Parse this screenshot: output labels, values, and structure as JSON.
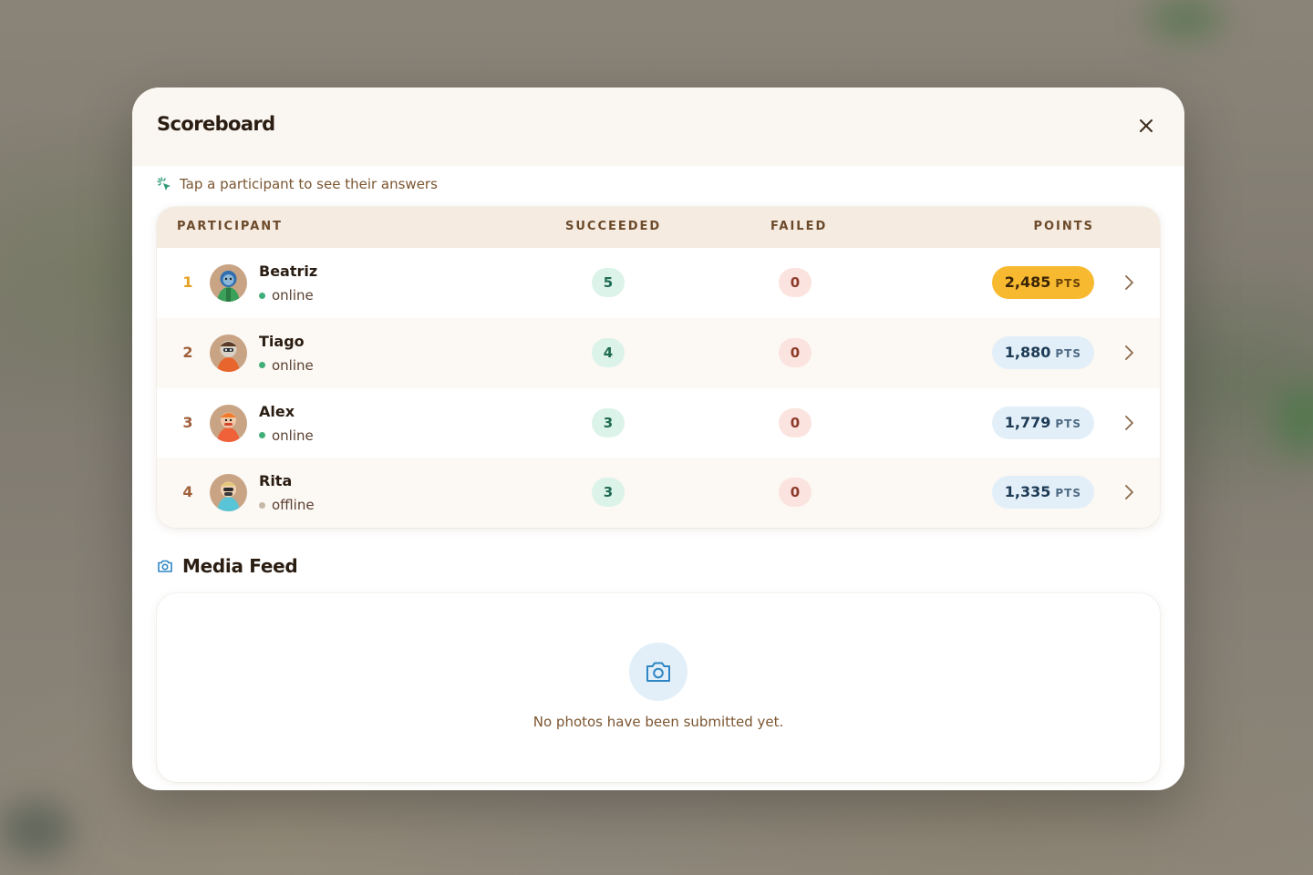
{
  "modal": {
    "title": "Scoreboard",
    "hint": "Tap a participant to see their answers"
  },
  "table": {
    "headers": {
      "participant": "PARTICIPANT",
      "succeeded": "SUCCEEDED",
      "failed": "FAILED",
      "points": "POINTS"
    },
    "rows": [
      {
        "rank": "1",
        "name": "Beatriz",
        "status": "online",
        "succeeded": "5",
        "failed": "0",
        "points": "2,485",
        "unit": "PTS"
      },
      {
        "rank": "2",
        "name": "Tiago",
        "status": "online",
        "succeeded": "4",
        "failed": "0",
        "points": "1,880",
        "unit": "PTS"
      },
      {
        "rank": "3",
        "name": "Alex",
        "status": "online",
        "succeeded": "3",
        "failed": "0",
        "points": "1,779",
        "unit": "PTS"
      },
      {
        "rank": "4",
        "name": "Rita",
        "status": "offline",
        "succeeded": "3",
        "failed": "0",
        "points": "1,335",
        "unit": "PTS"
      }
    ]
  },
  "media": {
    "title": "Media Feed",
    "empty": "No photos have been submitted yet."
  },
  "colors": {
    "gold": "#f7b930",
    "online": "#3fae78",
    "offline": "#c6b8a6",
    "succeeded_bg": "#dcf3ea",
    "failed_bg": "#fbe3df",
    "points_bg": "#e3eff8"
  },
  "icons": {
    "close": "close-icon",
    "hint": "tap-sparkle-icon",
    "media": "camera-icon",
    "row_action": "chevron-right-icon"
  }
}
